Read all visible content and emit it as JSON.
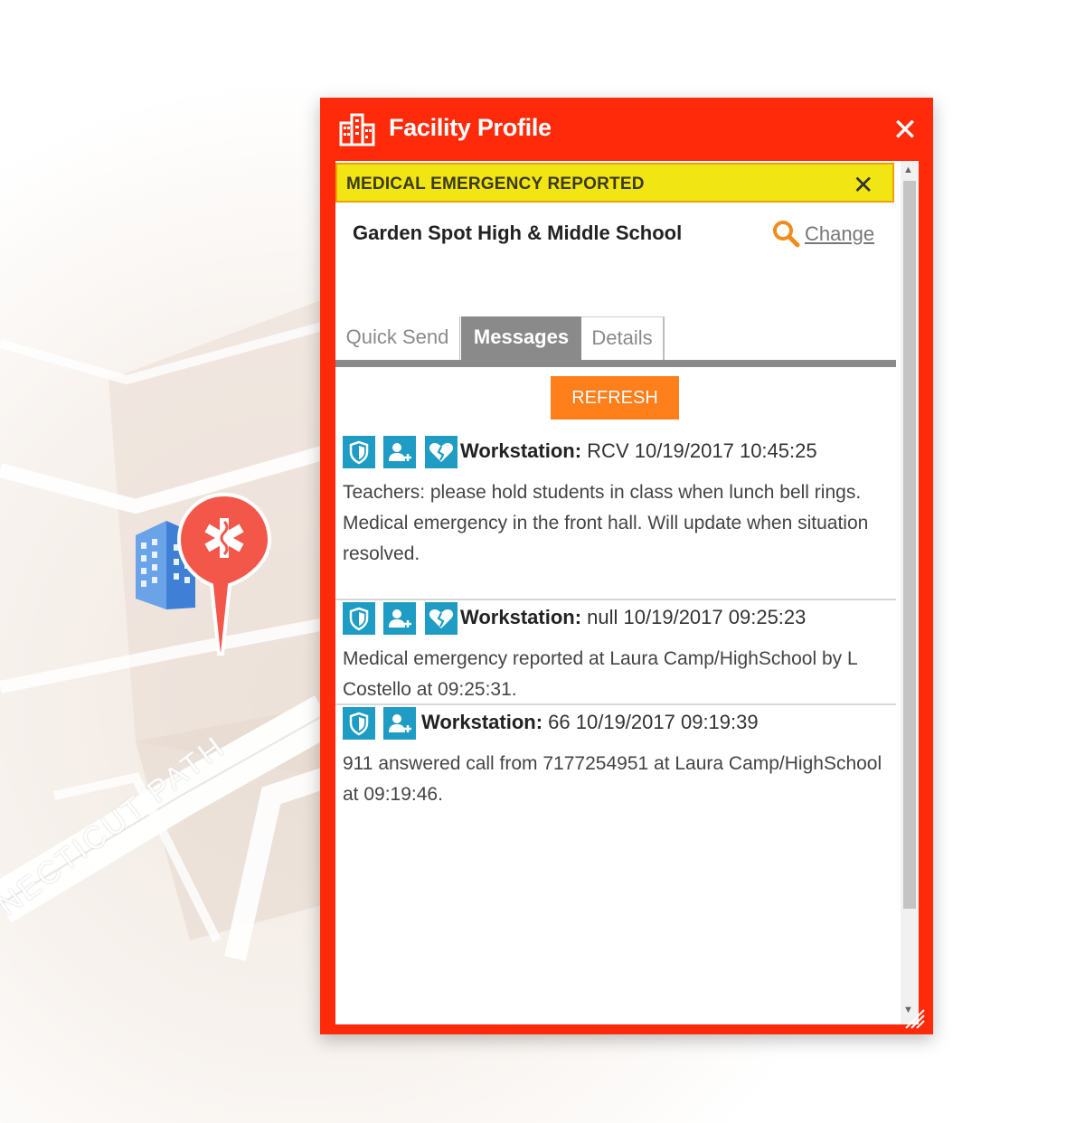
{
  "map": {
    "road_label": "NECTICUT PATH",
    "building_icon": "building-icon",
    "pin_icon": "medical-star-of-life-icon"
  },
  "panel": {
    "title": "Facility Profile",
    "header_icon": "buildings-icon",
    "close_icon": "close-icon",
    "accent_color": "#ff2a0a"
  },
  "alert": {
    "text": "MEDICAL EMERGENCY REPORTED",
    "close_icon": "close-icon",
    "color": "#f2e514"
  },
  "facility": {
    "name": "Garden Spot High & Middle School",
    "change_label": "Change",
    "search_icon": "search-icon"
  },
  "tabs": [
    {
      "label": "Quick Send",
      "active": false
    },
    {
      "label": "Messages",
      "active": true
    },
    {
      "label": "Details",
      "active": false
    }
  ],
  "refresh_label": "REFRESH",
  "messages": [
    {
      "icons": [
        "shield-icon",
        "add-user-icon",
        "broken-heart-icon"
      ],
      "workstation_label": "Workstation:",
      "meta": "RCV 10/19/2017 10:45:25",
      "text": "Teachers: please hold students in class when lunch bell rings. Medical emergency in the front hall. Will update when situation resolved."
    },
    {
      "icons": [
        "shield-icon",
        "add-user-icon",
        "broken-heart-icon"
      ],
      "workstation_label": "Workstation:",
      "meta": "null 10/19/2017 09:25:23",
      "text": "Medical emergency reported at Laura Camp/HighSchool by L Costello at 09:25:31."
    },
    {
      "icons": [
        "shield-icon",
        "add-user-icon"
      ],
      "workstation_label": "Workstation:",
      "meta": "66 10/19/2017 09:19:39",
      "text": "911 answered call from 7177254951 at Laura Camp/HighSchool at 09:19:46."
    }
  ],
  "colors": {
    "badge": "#1e9cc4",
    "refresh": "#ff7f1a",
    "tab_active": "#8a8a8a"
  }
}
